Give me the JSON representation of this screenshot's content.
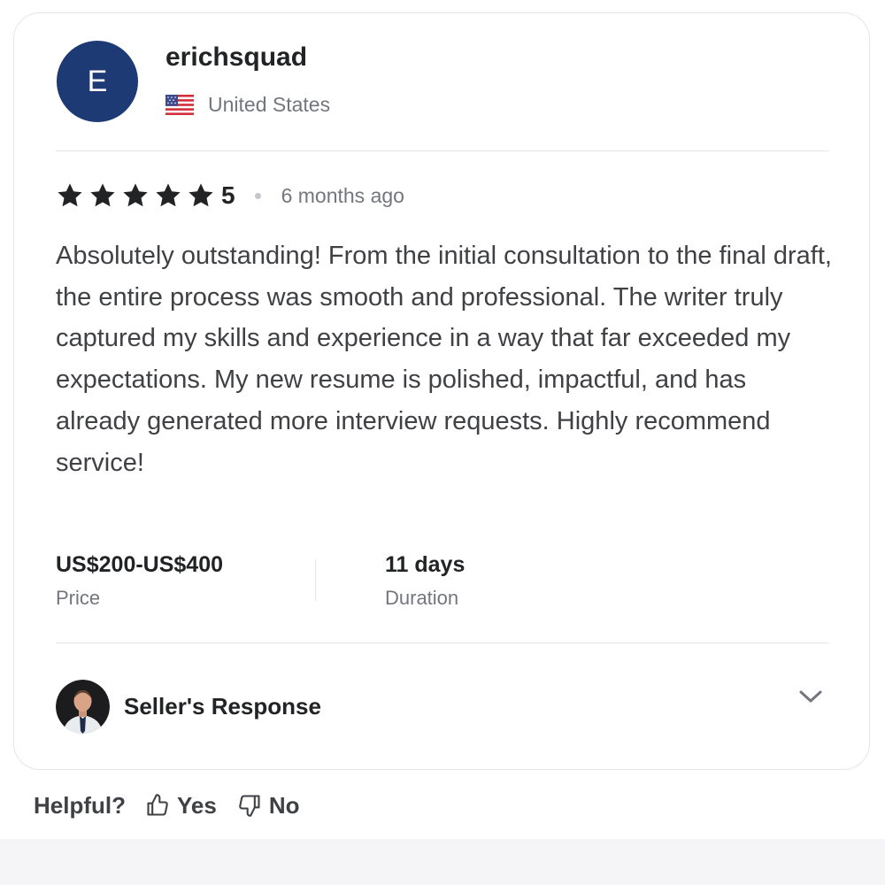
{
  "reviewer": {
    "avatar_initial": "E",
    "username": "erichsquad",
    "country": "United States",
    "flag_icon": "us-flag-icon"
  },
  "rating": {
    "stars": 5,
    "value": "5",
    "time_ago": "6 months ago"
  },
  "review": {
    "text": "Absolutely outstanding! From the initial consultation to the final draft, the entire process was smooth and professional. The writer truly captured my skills and experience in a way that far exceeded my expectations. My new resume is polished, impactful, and has already generated more interview requests. Highly recommend service!"
  },
  "stats": {
    "price_value": "US$200-US$400",
    "price_label": "Price",
    "duration_value": "11 days",
    "duration_label": "Duration"
  },
  "seller_response": {
    "label": "Seller's Response",
    "expand_icon": "chevron-down-icon"
  },
  "helpful": {
    "label": "Helpful?",
    "yes_label": "Yes",
    "no_label": "No"
  },
  "colors": {
    "avatar_bg": "#1e3a74",
    "text_primary": "#222325",
    "text_body": "#404145",
    "text_muted": "#74767e",
    "border": "#e4e5e7",
    "footer_bg": "#f5f5f7"
  }
}
